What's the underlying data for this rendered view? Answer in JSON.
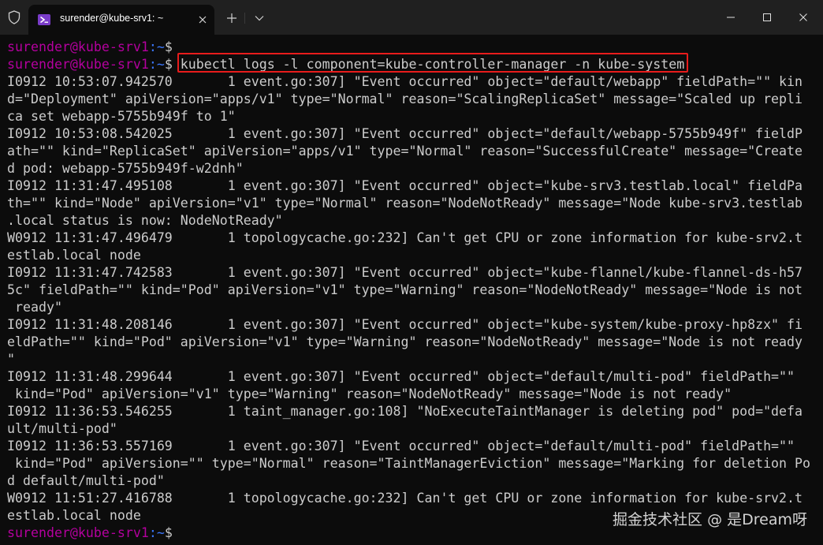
{
  "window": {
    "tab_title": "surender@kube-srv1: ~",
    "icons": {
      "shield": "shield-icon",
      "tab": "powershell-icon",
      "close_tab": "close-icon",
      "new_tab": "plus-icon",
      "dropdown": "chevron-down-icon",
      "minimize": "minimize-icon",
      "maximize": "maximize-icon",
      "close_window": "close-icon"
    }
  },
  "colors": {
    "prompt_user": "#b4009e",
    "prompt_path": "#3b78ff",
    "text": "#cccccc",
    "background": "#0c0c0c",
    "highlight_border": "#e81c1c"
  },
  "terminal": {
    "prompt_user": "surender@kube-srv1",
    "prompt_path": ":~",
    "prompt_sign": "$",
    "command": " kubectl logs -l component=kube-controller-manager -n kube-system",
    "lines": [
      "I0912 10:53:07.942570       1 event.go:307] \"Event occurred\" object=\"default/webapp\" fieldPath=\"\" kin",
      "d=\"Deployment\" apiVersion=\"apps/v1\" type=\"Normal\" reason=\"ScalingReplicaSet\" message=\"Scaled up repli",
      "ca set webapp-5755b949f to 1\"",
      "I0912 10:53:08.542025       1 event.go:307] \"Event occurred\" object=\"default/webapp-5755b949f\" fieldP",
      "ath=\"\" kind=\"ReplicaSet\" apiVersion=\"apps/v1\" type=\"Normal\" reason=\"SuccessfulCreate\" message=\"Create",
      "d pod: webapp-5755b949f-w2dnh\"",
      "I0912 11:31:47.495108       1 event.go:307] \"Event occurred\" object=\"kube-srv3.testlab.local\" fieldPa",
      "th=\"\" kind=\"Node\" apiVersion=\"v1\" type=\"Normal\" reason=\"NodeNotReady\" message=\"Node kube-srv3.testlab",
      ".local status is now: NodeNotReady\"",
      "W0912 11:31:47.496479       1 topologycache.go:232] Can't get CPU or zone information for kube-srv2.t",
      "estlab.local node",
      "I0912 11:31:47.742583       1 event.go:307] \"Event occurred\" object=\"kube-flannel/kube-flannel-ds-h57",
      "5c\" fieldPath=\"\" kind=\"Pod\" apiVersion=\"v1\" type=\"Warning\" reason=\"NodeNotReady\" message=\"Node is not",
      " ready\"",
      "I0912 11:31:48.208146       1 event.go:307] \"Event occurred\" object=\"kube-system/kube-proxy-hp8zx\" fi",
      "eldPath=\"\" kind=\"Pod\" apiVersion=\"v1\" type=\"Warning\" reason=\"NodeNotReady\" message=\"Node is not ready",
      "\"",
      "I0912 11:31:48.299644       1 event.go:307] \"Event occurred\" object=\"default/multi-pod\" fieldPath=\"\"",
      " kind=\"Pod\" apiVersion=\"v1\" type=\"Warning\" reason=\"NodeNotReady\" message=\"Node is not ready\"",
      "I0912 11:36:53.546255       1 taint_manager.go:108] \"NoExecuteTaintManager is deleting pod\" pod=\"defa",
      "ult/multi-pod\"",
      "I0912 11:36:53.557169       1 event.go:307] \"Event occurred\" object=\"default/multi-pod\" fieldPath=\"\"",
      " kind=\"Pod\" apiVersion=\"\" type=\"Normal\" reason=\"TaintManagerEviction\" message=\"Marking for deletion Po",
      "d default/multi-pod\"",
      "W0912 11:51:27.416788       1 topologycache.go:232] Can't get CPU or zone information for kube-srv2.t",
      "estlab.local node"
    ]
  },
  "watermark": "掘金技术社区 @ 是Dream呀"
}
